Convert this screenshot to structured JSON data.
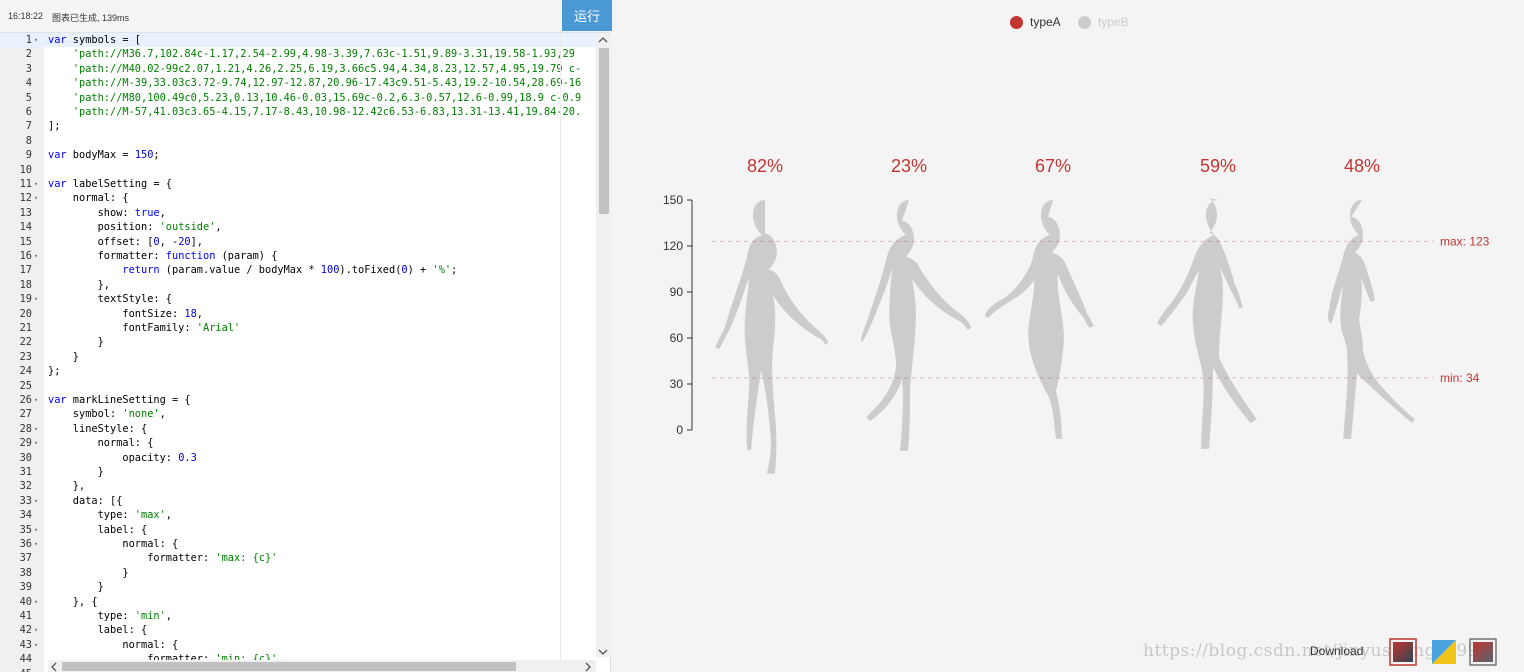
{
  "toolbar": {
    "time": "16:18:22",
    "message": "图表已生成, 139ms",
    "run_label": "运行"
  },
  "editor": {
    "lines": [
      {
        "n": "1",
        "f": "▾",
        "t": "var symbols = [",
        "c": "k"
      },
      {
        "n": "2",
        "f": "",
        "t": "    'path://M36.7,102.84c-1.17,2.54-2.99,4.98-3.39,7.63c-1.51,9.89-3.31,19.58-1.93,29",
        "c": "s"
      },
      {
        "n": "3",
        "f": "",
        "t": "    'path://M40.02-99c2.07,1.21,4.26,2.25,6.19,3.66c5.94,4.34,8.23,12.57,4.95,19.79 c-",
        "c": "s"
      },
      {
        "n": "4",
        "f": "",
        "t": "    'path://M-39,33.03c3.72-9.74,12.97-12.87,20.96-17.43c9.51-5.43,19.2-10.54,28.69-16",
        "c": "s"
      },
      {
        "n": "5",
        "f": "",
        "t": "    'path://M80,100.49c0,5.23,0.13,10.46-0.03,15.69c-0.2,6.3-0.57,12.6-0.99,18.9 c-0.9",
        "c": "s"
      },
      {
        "n": "6",
        "f": "",
        "t": "    'path://M-57,41.03c3.65-4.15,7.17-8.43,10.98-12.42c6.53-6.83,13.31-13.41,19.84-20.",
        "c": "s"
      },
      {
        "n": "7",
        "f": "",
        "t": "];",
        "c": ""
      },
      {
        "n": "8",
        "f": "",
        "t": "",
        "c": ""
      },
      {
        "n": "9",
        "f": "",
        "t": "var bodyMax = 150;",
        "c": "k"
      },
      {
        "n": "10",
        "f": "",
        "t": "",
        "c": ""
      },
      {
        "n": "11",
        "f": "▾",
        "t": "var labelSetting = {",
        "c": "k"
      },
      {
        "n": "12",
        "f": "▾",
        "t": "    normal: {",
        "c": ""
      },
      {
        "n": "13",
        "f": "",
        "t": "        show: true,",
        "c": ""
      },
      {
        "n": "14",
        "f": "",
        "t": "        position: 'outside',",
        "c": ""
      },
      {
        "n": "15",
        "f": "",
        "t": "        offset: [0, -20],",
        "c": ""
      },
      {
        "n": "16",
        "f": "▾",
        "t": "        formatter: function (param) {",
        "c": ""
      },
      {
        "n": "17",
        "f": "",
        "t": "            return (param.value / bodyMax * 100).toFixed(0) + '%';",
        "c": ""
      },
      {
        "n": "18",
        "f": "",
        "t": "        },",
        "c": ""
      },
      {
        "n": "19",
        "f": "▾",
        "t": "        textStyle: {",
        "c": ""
      },
      {
        "n": "20",
        "f": "",
        "t": "            fontSize: 18,",
        "c": ""
      },
      {
        "n": "21",
        "f": "",
        "t": "            fontFamily: 'Arial'",
        "c": ""
      },
      {
        "n": "22",
        "f": "",
        "t": "        }",
        "c": ""
      },
      {
        "n": "23",
        "f": "",
        "t": "    }",
        "c": ""
      },
      {
        "n": "24",
        "f": "",
        "t": "};",
        "c": ""
      },
      {
        "n": "25",
        "f": "",
        "t": "",
        "c": ""
      },
      {
        "n": "26",
        "f": "▾",
        "t": "var markLineSetting = {",
        "c": "k"
      },
      {
        "n": "27",
        "f": "",
        "t": "    symbol: 'none',",
        "c": ""
      },
      {
        "n": "28",
        "f": "▾",
        "t": "    lineStyle: {",
        "c": ""
      },
      {
        "n": "29",
        "f": "▾",
        "t": "        normal: {",
        "c": ""
      },
      {
        "n": "30",
        "f": "",
        "t": "            opacity: 0.3",
        "c": ""
      },
      {
        "n": "31",
        "f": "",
        "t": "        }",
        "c": ""
      },
      {
        "n": "32",
        "f": "",
        "t": "    },",
        "c": ""
      },
      {
        "n": "33",
        "f": "▾",
        "t": "    data: [{",
        "c": ""
      },
      {
        "n": "34",
        "f": "",
        "t": "        type: 'max',",
        "c": ""
      },
      {
        "n": "35",
        "f": "▾",
        "t": "        label: {",
        "c": ""
      },
      {
        "n": "36",
        "f": "▾",
        "t": "            normal: {",
        "c": ""
      },
      {
        "n": "37",
        "f": "",
        "t": "                formatter: 'max: {c}'",
        "c": ""
      },
      {
        "n": "38",
        "f": "",
        "t": "            }",
        "c": ""
      },
      {
        "n": "39",
        "f": "",
        "t": "        }",
        "c": ""
      },
      {
        "n": "40",
        "f": "▾",
        "t": "    }, {",
        "c": ""
      },
      {
        "n": "41",
        "f": "",
        "t": "        type: 'min',",
        "c": ""
      },
      {
        "n": "42",
        "f": "▾",
        "t": "        label: {",
        "c": ""
      },
      {
        "n": "43",
        "f": "▾",
        "t": "            normal: {",
        "c": ""
      },
      {
        "n": "44",
        "f": "",
        "t": "                formatter: 'min: {c}'",
        "c": ""
      },
      {
        "n": "45",
        "f": "",
        "t": "",
        "c": ""
      }
    ]
  },
  "legend": {
    "items": [
      {
        "label": "typeA",
        "color": "#c23531",
        "active": true
      },
      {
        "label": "typeB",
        "color": "#cccccc",
        "active": false
      }
    ]
  },
  "chart_data": {
    "type": "bar",
    "categories": [
      "",
      "",
      "",
      "",
      ""
    ],
    "series": [
      {
        "name": "typeA",
        "values": [
          123,
          34,
          100,
          88,
          72
        ],
        "color": "#c23531"
      }
    ],
    "percent_labels": [
      "82%",
      "23%",
      "67%",
      "59%",
      "48%"
    ],
    "body_max": 150,
    "ylim": [
      0,
      150
    ],
    "yticks": [
      "0",
      "30",
      "60",
      "90",
      "120",
      "150"
    ],
    "mark_lines": [
      {
        "label": "max: 123",
        "value": 123
      },
      {
        "label": "min: 34",
        "value": 34
      }
    ],
    "empty_color": "#cccccc"
  },
  "download": {
    "label": "Download"
  },
  "watermark": "https://blog.csdn.net/jinyusheng_1991"
}
